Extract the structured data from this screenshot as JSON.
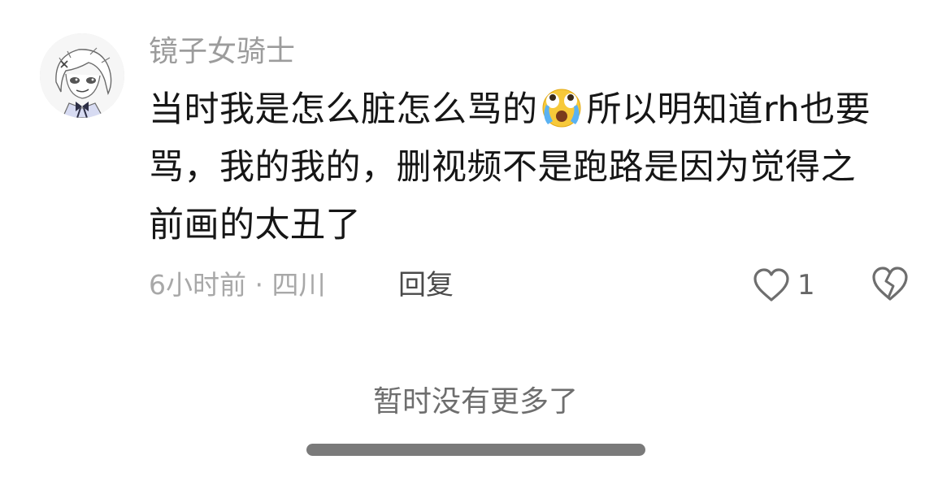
{
  "comment": {
    "username": "镜子女骑士",
    "text_line1_a": "当时我是怎么脏怎么骂的",
    "emoji": "crying-face-emoji",
    "text_line1_b": "所以明知道rh也要",
    "text_line2": "骂，我的我的，删视频不是跑路是因为觉得之",
    "text_line3": "前画的太丑了",
    "meta": "6小时前 · 四川",
    "reply_label": "回复",
    "like_count": "1",
    "icons": {
      "like": "heart-outline-icon",
      "dislike": "broken-heart-icon"
    }
  },
  "footer": {
    "no_more": "暂时没有更多了"
  },
  "colors": {
    "username": "#9c9c9c",
    "text": "#161616",
    "meta": "#a8a8a8",
    "scrollbar": "#7a7a7a"
  }
}
